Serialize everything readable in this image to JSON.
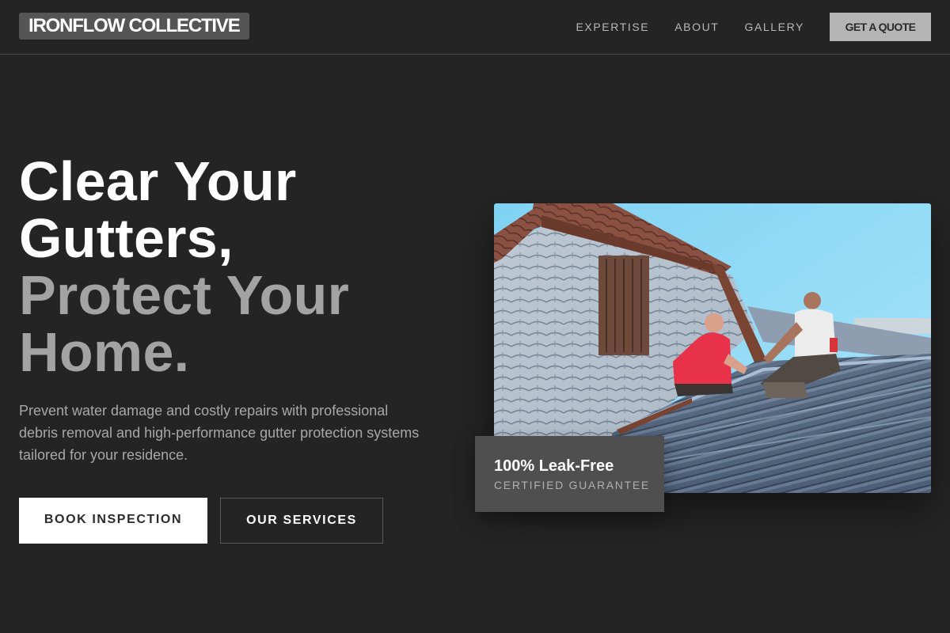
{
  "nav": {
    "logo": "IRONFLOW COLLECTIVE",
    "links": [
      {
        "label": "EXPERTISE"
      },
      {
        "label": "ABOUT"
      },
      {
        "label": "GALLERY"
      }
    ],
    "cta_label": "GET A QUOTE"
  },
  "hero": {
    "headline_lines": [
      {
        "text": "Clear Your"
      },
      {
        "text": "Gutters,"
      },
      {
        "text": "Protect Your"
      },
      {
        "text": "Home."
      }
    ],
    "lead": "Prevent water damage and costly repairs with professional debris removal and high-performance gutter protection systems tailored for your residence.",
    "primary_button": "BOOK INSPECTION",
    "secondary_button": "OUR SERVICES"
  },
  "badge": {
    "title": "100% Leak-Free",
    "subtitle": "CERTIFIED GUARANTEE"
  },
  "colors": {
    "background": "#242424",
    "headline_primary": "#ffffff",
    "headline_accent": "#a3a3a3",
    "badge_bg": "#4f4f4f"
  }
}
